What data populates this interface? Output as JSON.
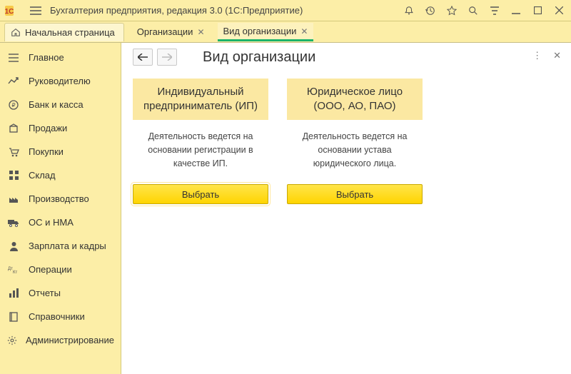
{
  "app": {
    "title": "Бухгалтерия предприятия, редакция 3.0  (1С:Предприятие)"
  },
  "tabs": {
    "home": "Начальная страница",
    "t1": "Организации",
    "t2": "Вид организации"
  },
  "sidebar": {
    "items": [
      {
        "label": "Главное"
      },
      {
        "label": "Руководителю"
      },
      {
        "label": "Банк и касса"
      },
      {
        "label": "Продажи"
      },
      {
        "label": "Покупки"
      },
      {
        "label": "Склад"
      },
      {
        "label": "Производство"
      },
      {
        "label": "ОС и НМА"
      },
      {
        "label": "Зарплата и кадры"
      },
      {
        "label": "Операции"
      },
      {
        "label": "Отчеты"
      },
      {
        "label": "Справочники"
      },
      {
        "label": "Администрирование"
      }
    ]
  },
  "page": {
    "title": "Вид организации",
    "card1": {
      "heading": "Индивидуальный предприниматель (ИП)",
      "desc": "Деятельность ведется на основании регистрации в качестве ИП.",
      "button": "Выбрать"
    },
    "card2": {
      "heading": "Юридическое лицо (ООО, АО, ПАО)",
      "desc": "Деятельность ведется на основании устава юридического лица.",
      "button": "Выбрать"
    }
  }
}
